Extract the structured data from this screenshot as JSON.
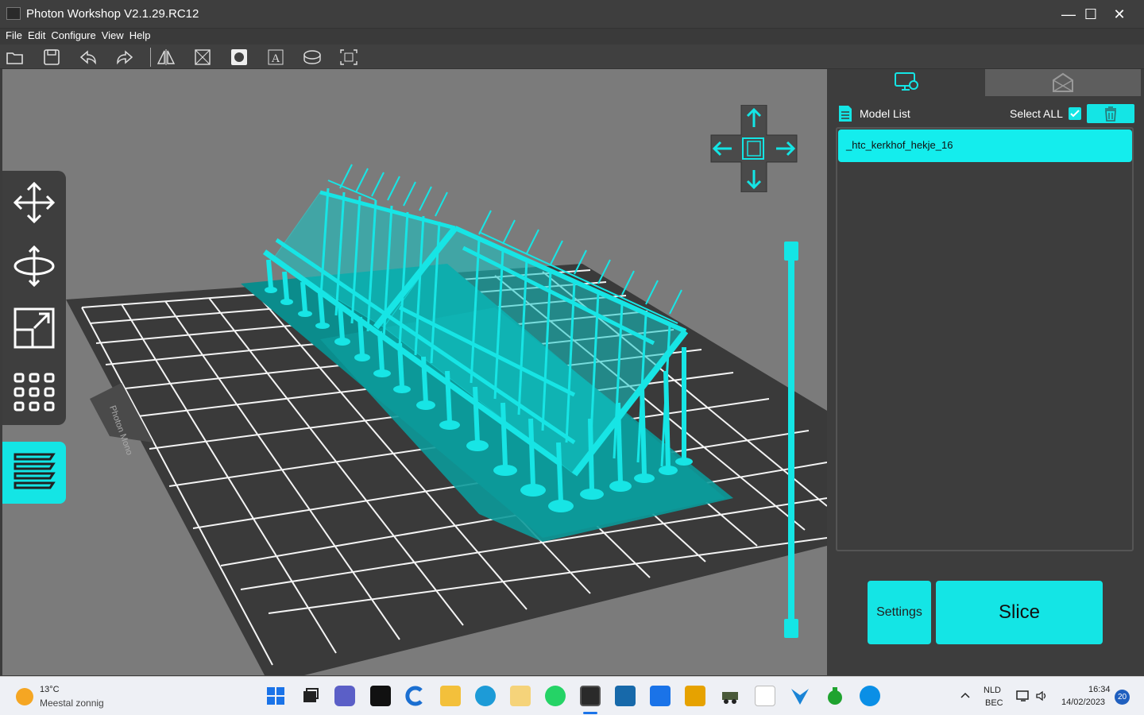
{
  "window": {
    "title": "Photon Workshop V2.1.29.RC12",
    "minimize": "—",
    "maximize": "☐",
    "close": "✕"
  },
  "menu": [
    "File",
    "Edit",
    "Configure",
    "View",
    "Help"
  ],
  "toolbar_icons": [
    "open-folder-icon",
    "save-icon",
    "undo-icon",
    "redo-icon",
    "mirror-icon",
    "hollow-icon",
    "punch-hole-icon",
    "text-icon",
    "plate-icon",
    "camera-view-icon"
  ],
  "left_tools": [
    "move-icon",
    "rotate-icon",
    "scale-icon",
    "arrange-icon",
    "layers-icon"
  ],
  "viewport": {
    "plate_label": "Photon Mono"
  },
  "panel": {
    "model_list_label": "Model List",
    "select_all_label": "Select ALL",
    "select_all_checked": true,
    "models": [
      "_htc_kerkhof_hekje_16"
    ],
    "settings_label": "Settings",
    "slice_label": "Slice"
  },
  "taskbar": {
    "weather_temp": "13°C",
    "weather_desc": "Meestal zonnig",
    "lang_top": "NLD",
    "lang_bottom": "BEC",
    "time": "16:34",
    "date": "14/02/2023",
    "notifications": "20"
  },
  "colors": {
    "accent": "#14e5e5",
    "dark_panel": "#3d3d3d",
    "viewport": "#7b7b7b"
  }
}
